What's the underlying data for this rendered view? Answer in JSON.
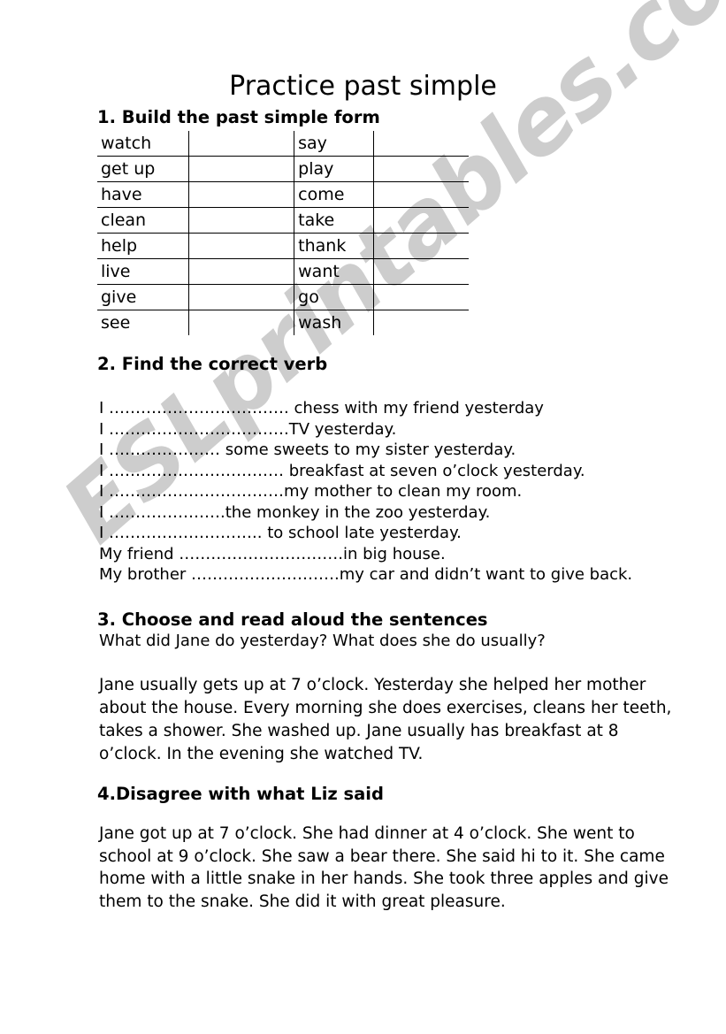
{
  "document": {
    "title": "Practice past simple",
    "watermark": "ESLprintables.com",
    "watermark_color": "#cdcdcd",
    "page_background": "#ffffff",
    "text_color": "#000000"
  },
  "exercise1": {
    "heading": "1. Build the past simple form",
    "rows": [
      {
        "left_verb": "watch",
        "left_answer": "",
        "right_verb": "say",
        "right_answer": ""
      },
      {
        "left_verb": "get up",
        "left_answer": "",
        "right_verb": "play",
        "right_answer": ""
      },
      {
        "left_verb": "have",
        "left_answer": "",
        "right_verb": "come",
        "right_answer": ""
      },
      {
        "left_verb": "clean",
        "left_answer": "",
        "right_verb": "take",
        "right_answer": ""
      },
      {
        "left_verb": "help",
        "left_answer": "",
        "right_verb": "thank",
        "right_answer": ""
      },
      {
        "left_verb": "live",
        "left_answer": "",
        "right_verb": "want",
        "right_answer": ""
      },
      {
        "left_verb": "give",
        "left_answer": "",
        "right_verb": "go",
        "right_answer": ""
      },
      {
        "left_verb": "see",
        "left_answer": "",
        "right_verb": "wash",
        "right_answer": ""
      }
    ]
  },
  "exercise2": {
    "heading": "2. Find the correct verb",
    "lines": [
      "I ……………………………. chess with my friend yesterday",
      "I …………………………….TV yesterday.",
      "I ………………… some sweets to my sister yesterday.",
      "I …………………………… breakfast at seven o’clock yesterday.",
      "I ……………………………my mother to clean my room.",
      "I ………………….the monkey in the zoo  yesterday.",
      "I ……………………….. to school late yesterday.",
      "My friend ………………………….in big house.",
      "My brother ……………………….my car and didn’t want to give back."
    ]
  },
  "exercise3": {
    "heading": "3. Choose and read aloud the sentences",
    "question": "What did Jane do yesterday? What does she do usually?",
    "passage": "Jane usually gets up at 7 o’clock. Yesterday she helped her mother about the house. Every morning she does exercises, cleans her teeth, takes a shower. She washed up. Jane usually has breakfast at 8 o’clock. In the evening she watched TV."
  },
  "exercise4": {
    "heading": "4.Disagree with what Liz said",
    "passage": "Jane got up at 7 o’clock. She had dinner at 4 o’clock. She went to school at 9 o’clock. She saw a bear there. She said hi to it. She came home with a little snake in her hands. She took three apples and give them to the snake. She did it with great pleasure."
  }
}
